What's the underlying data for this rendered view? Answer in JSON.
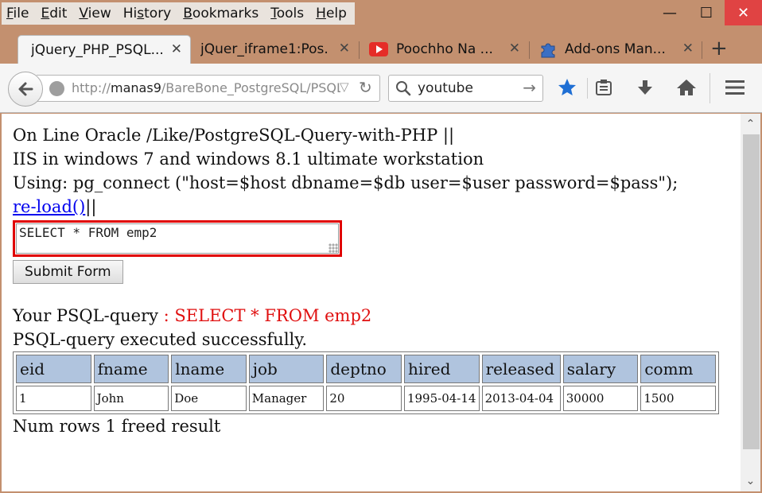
{
  "menu": {
    "items": [
      {
        "first": "F",
        "rest": "ile"
      },
      {
        "first": "E",
        "rest": "dit"
      },
      {
        "first": "V",
        "rest": "iew"
      },
      {
        "first": "",
        "rest": "History",
        "mid": "s"
      },
      {
        "first": "B",
        "rest": "ookmarks"
      },
      {
        "first": "T",
        "rest": "ools"
      },
      {
        "first": "H",
        "rest": "elp"
      }
    ]
  },
  "window": {
    "minimize": "—",
    "maximize": "☐",
    "close": "✕"
  },
  "tabs": [
    {
      "label": "jQuery_PHP_PSQL...",
      "close": "✕",
      "active": true
    },
    {
      "label": "jQuer_iframe1:Pos...",
      "close": "✕"
    },
    {
      "label": "Poochho Na ...",
      "close": "✕",
      "icon": "youtube-icon"
    },
    {
      "label": "Add-ons Man...",
      "close": "✕",
      "icon": "puzzle-icon"
    }
  ],
  "new_tab": "+",
  "nav": {
    "url_scheme": "http://",
    "url_host": "manas9",
    "url_path": "/BareBone_PostgreSQL/PSQL",
    "search_value": "youtube",
    "icons": [
      "back-icon",
      "globe-icon",
      "dropdown-icon",
      "reload-icon",
      "search-icon",
      "go-arrow-icon",
      "bookmark-star-icon",
      "reading-list-icon",
      "download-icon",
      "home-icon",
      "menu-icon"
    ]
  },
  "page": {
    "line1": "On Line Oracle /Like/PostgreSQL-Query-with-PHP ||",
    "line2": "IIS in windows 7 and windows 8.1 ultimate workstation",
    "line3": "Using: pg_connect (\"host=$host dbname=$db user=$user password=$pass\");",
    "reload_link": "re-load()",
    "reload_suffix": "||",
    "query_value": "SELECT * FROM emp2",
    "submit_label": "Submit Form",
    "result_prefix": "Your PSQL-query",
    "result_query": " : SELECT * FROM emp2",
    "status": "PSQL-query executed successfully.",
    "footer": "Num rows 1 freed result"
  },
  "table": {
    "columns": [
      "eid",
      "fname",
      "lname",
      "job",
      "deptno",
      "hired",
      "released",
      "salary",
      "comm"
    ],
    "rows": [
      [
        "1",
        "John",
        "Doe",
        "Manager",
        "20",
        "1995-04-14",
        "2013-04-04",
        "30000",
        "1500"
      ]
    ]
  },
  "colors": {
    "accent_red": "#e01010",
    "header_bg": "#b0c4de",
    "link": "#0000ee",
    "title_bar": "#c3906f"
  }
}
